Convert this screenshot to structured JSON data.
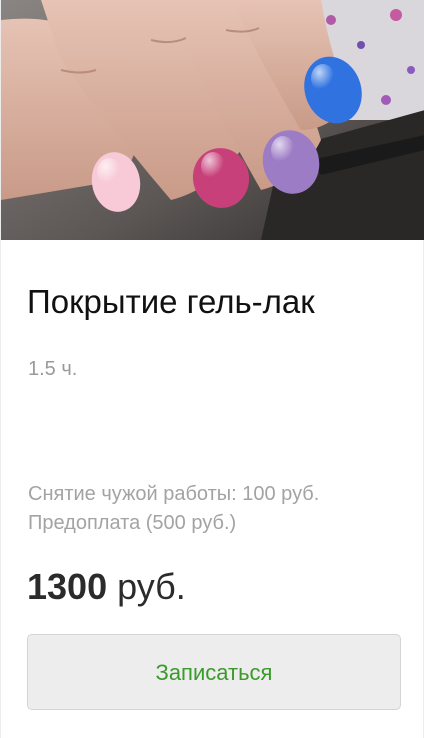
{
  "service": {
    "photo_alt": "nail-photo",
    "title": "Покрытие гель-лак",
    "duration": "1.5 ч.",
    "notes": [
      "Снятие чужой работы: 100 руб.",
      "Предоплата (500 руб.)"
    ],
    "price_amount": "1300",
    "price_currency": "руб.",
    "book_label": "Записаться"
  },
  "colors": {
    "accent_green": "#3a9a2a",
    "nail_pink_light": "#f8c9d6",
    "nail_pink": "#c8407a",
    "nail_lilac": "#9d7cc6",
    "nail_blue": "#2f72e0"
  }
}
